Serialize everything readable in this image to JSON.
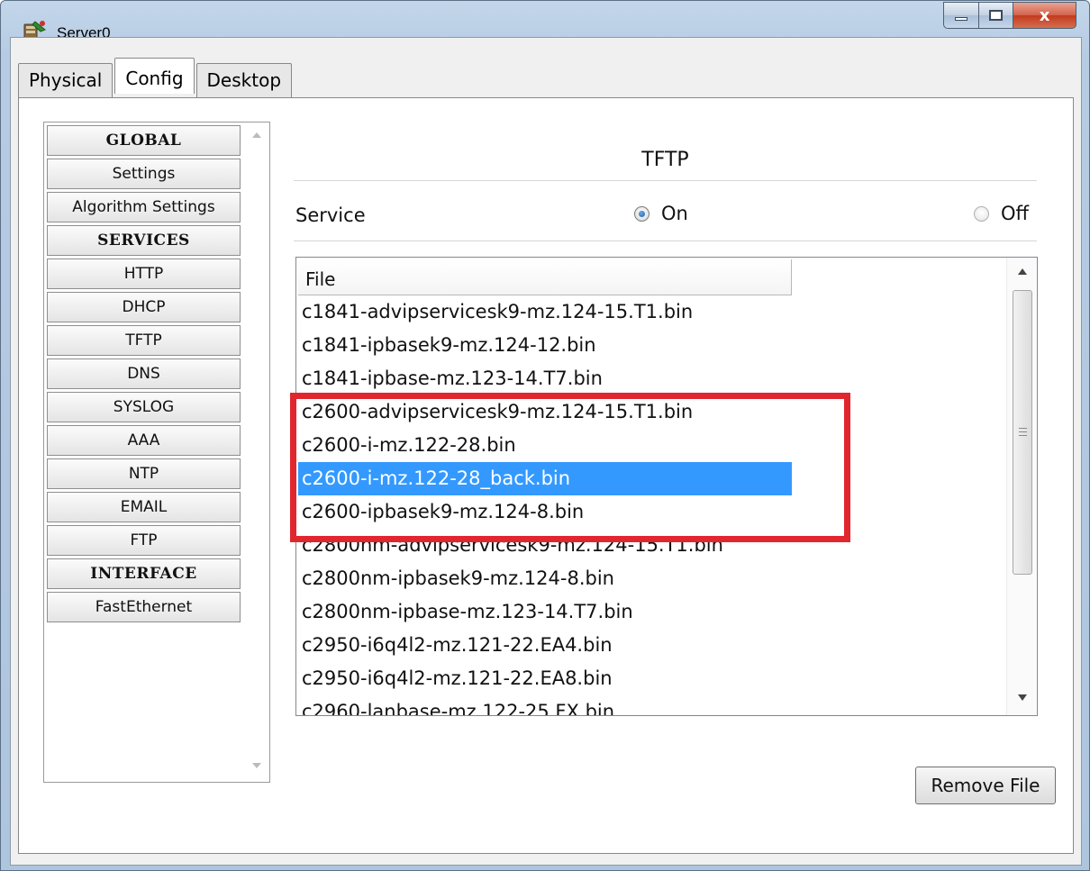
{
  "window": {
    "title": "Server0",
    "icon": "server-icon",
    "controls": [
      "minimize-icon",
      "maximize-icon",
      "close-icon"
    ],
    "close_glyph": "x"
  },
  "tabs": [
    {
      "label": "Physical",
      "active": false
    },
    {
      "label": "Config",
      "active": true
    },
    {
      "label": "Desktop",
      "active": false
    }
  ],
  "sidebar": {
    "items": [
      {
        "label": "GLOBAL",
        "type": "header"
      },
      {
        "label": "Settings",
        "type": "item"
      },
      {
        "label": "Algorithm Settings",
        "type": "item"
      },
      {
        "label": "SERVICES",
        "type": "header"
      },
      {
        "label": "HTTP",
        "type": "item"
      },
      {
        "label": "DHCP",
        "type": "item"
      },
      {
        "label": "TFTP",
        "type": "item"
      },
      {
        "label": "DNS",
        "type": "item"
      },
      {
        "label": "SYSLOG",
        "type": "item"
      },
      {
        "label": "AAA",
        "type": "item"
      },
      {
        "label": "NTP",
        "type": "item"
      },
      {
        "label": "EMAIL",
        "type": "item"
      },
      {
        "label": "FTP",
        "type": "item"
      },
      {
        "label": "INTERFACE",
        "type": "header"
      },
      {
        "label": "FastEthernet",
        "type": "item"
      }
    ]
  },
  "main": {
    "heading": "TFTP",
    "service_label": "Service",
    "service_on_label": "On",
    "service_off_label": "Off",
    "service_selected": "On",
    "file_column_header": "File",
    "files": [
      "c1841-advipservicesk9-mz.124-15.T1.bin",
      "c1841-ipbasek9-mz.124-12.bin",
      "c1841-ipbase-mz.123-14.T7.bin",
      "c2600-advipservicesk9-mz.124-15.T1.bin",
      "c2600-i-mz.122-28.bin",
      "c2600-i-mz.122-28_back.bin",
      "c2600-ipbasek9-mz.124-8.bin",
      "c2800nm-advipservicesk9-mz.124-15.T1.bin",
      "c2800nm-ipbasek9-mz.124-8.bin",
      "c2800nm-ipbase-mz.123-14.T7.bin",
      "c2950-i6q4l2-mz.121-22.EA4.bin",
      "c2950-i6q4l2-mz.121-22.EA8.bin",
      "c2960-lanbase-mz.122-25.FX.bin"
    ],
    "selected_file": "c2600-i-mz.122-28_back.bin",
    "remove_button_label": "Remove File"
  },
  "colors": {
    "selection": "#3399ff",
    "highlight_border": "#e1262e"
  }
}
